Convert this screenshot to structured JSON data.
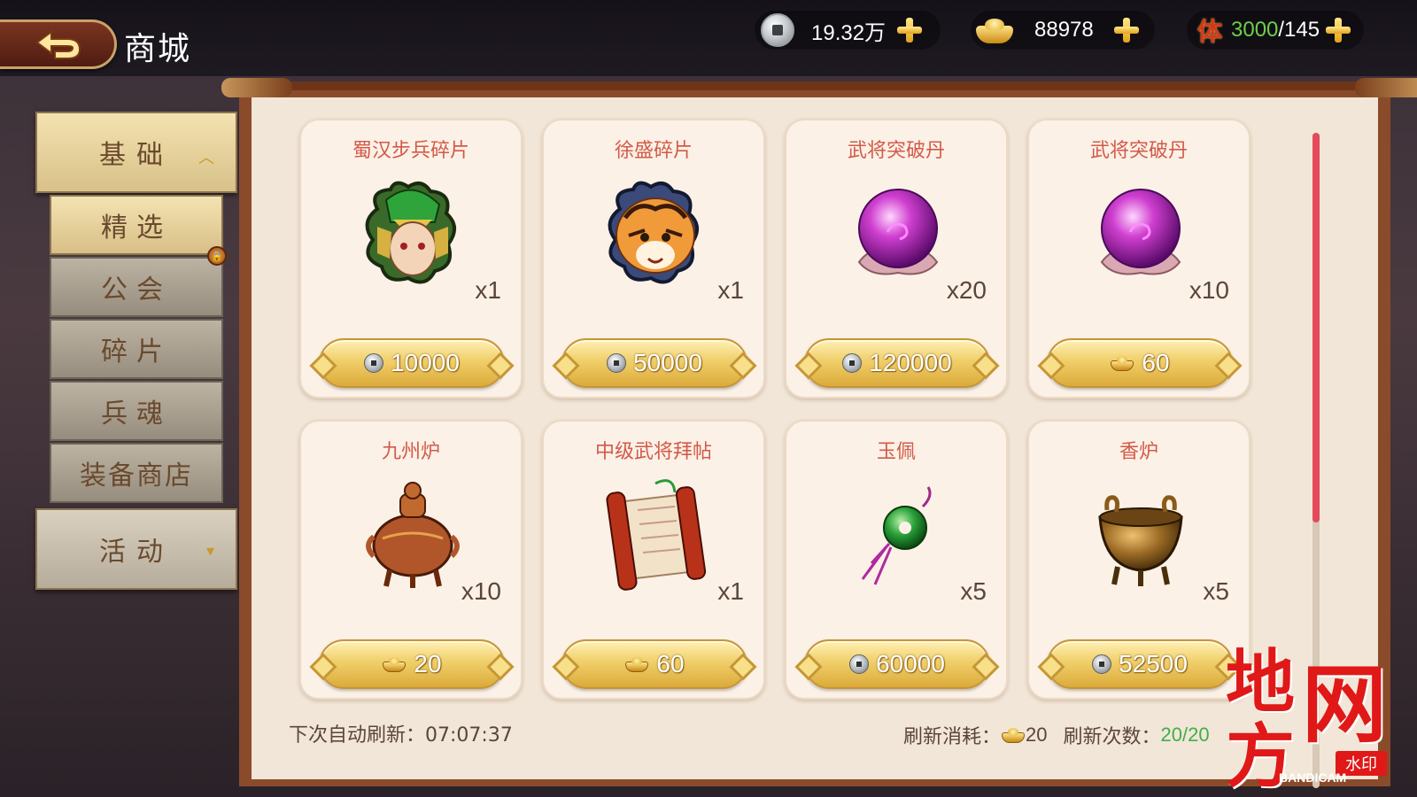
{
  "header": {
    "title": "商城",
    "silver": "19.32万",
    "gold": "88978",
    "stamina_icon": "体",
    "stamina_current": "3000",
    "stamina_max": "/145"
  },
  "menu": {
    "category_basic": "基础",
    "category_activity": "活动",
    "sub_items": [
      {
        "label": "精选",
        "selected": true
      },
      {
        "label": "公会",
        "locked": true
      },
      {
        "label": "碎片"
      },
      {
        "label": "兵魂"
      },
      {
        "label": "装备商店"
      }
    ]
  },
  "items": [
    {
      "name": "蜀汉步兵碎片",
      "qty": "x1",
      "price": "10000",
      "currency": "silver",
      "icon": "soldier-fragment-icon"
    },
    {
      "name": "徐盛碎片",
      "qty": "x1",
      "price": "50000",
      "currency": "silver",
      "icon": "general-fragment-icon"
    },
    {
      "name": "武将突破丹",
      "qty": "x20",
      "price": "120000",
      "currency": "silver",
      "icon": "breakthrough-pill-icon"
    },
    {
      "name": "武将突破丹",
      "qty": "x10",
      "price": "60",
      "currency": "gold",
      "icon": "breakthrough-pill-icon"
    },
    {
      "name": "九州炉",
      "qty": "x10",
      "price": "20",
      "currency": "gold",
      "icon": "censer-icon"
    },
    {
      "name": "中级武将拜帖",
      "qty": "x1",
      "price": "60",
      "currency": "gold",
      "icon": "scroll-icon"
    },
    {
      "name": "玉佩",
      "qty": "x5",
      "price": "60000",
      "currency": "silver",
      "icon": "jade-pendant-icon"
    },
    {
      "name": "香炉",
      "qty": "x5",
      "price": "52500",
      "currency": "silver",
      "icon": "incense-burner-icon"
    }
  ],
  "footer": {
    "refresh_label": "下次自动刷新：",
    "refresh_time": "07:07:37",
    "cost_label": "刷新消耗：",
    "cost_value": "20",
    "count_label": "刷新次数：",
    "count_value": "20/20"
  },
  "watermark": {
    "chars": [
      "地",
      "方",
      "网"
    ],
    "stamp": "水印",
    "brand": "BANDICAM"
  },
  "colors": {
    "item_name": "#d35a4a",
    "scroll_thumb": "#e34a5a",
    "stamina_current": "#6cd04a",
    "refresh_count": "#3cb04a"
  }
}
